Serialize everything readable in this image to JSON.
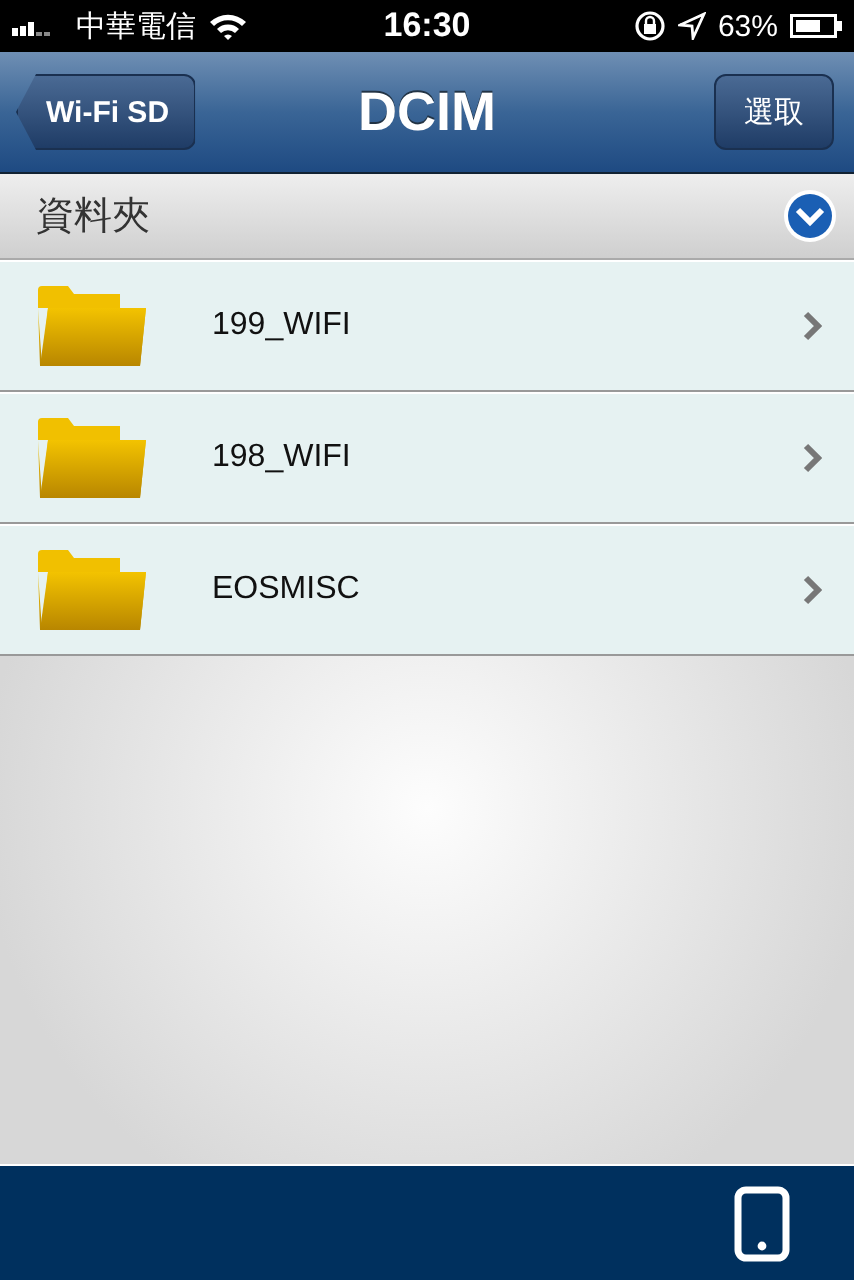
{
  "status_bar": {
    "carrier": "中華電信",
    "time": "16:30",
    "battery": "63%"
  },
  "nav_bar": {
    "back": "Wi-Fi SD",
    "title": "DCIM",
    "action": "選取"
  },
  "section": {
    "title": "資料夾",
    "expanded": true
  },
  "folders": [
    {
      "name": "199_WIFI"
    },
    {
      "name": "198_WIFI"
    },
    {
      "name": "EOSMISC"
    }
  ]
}
